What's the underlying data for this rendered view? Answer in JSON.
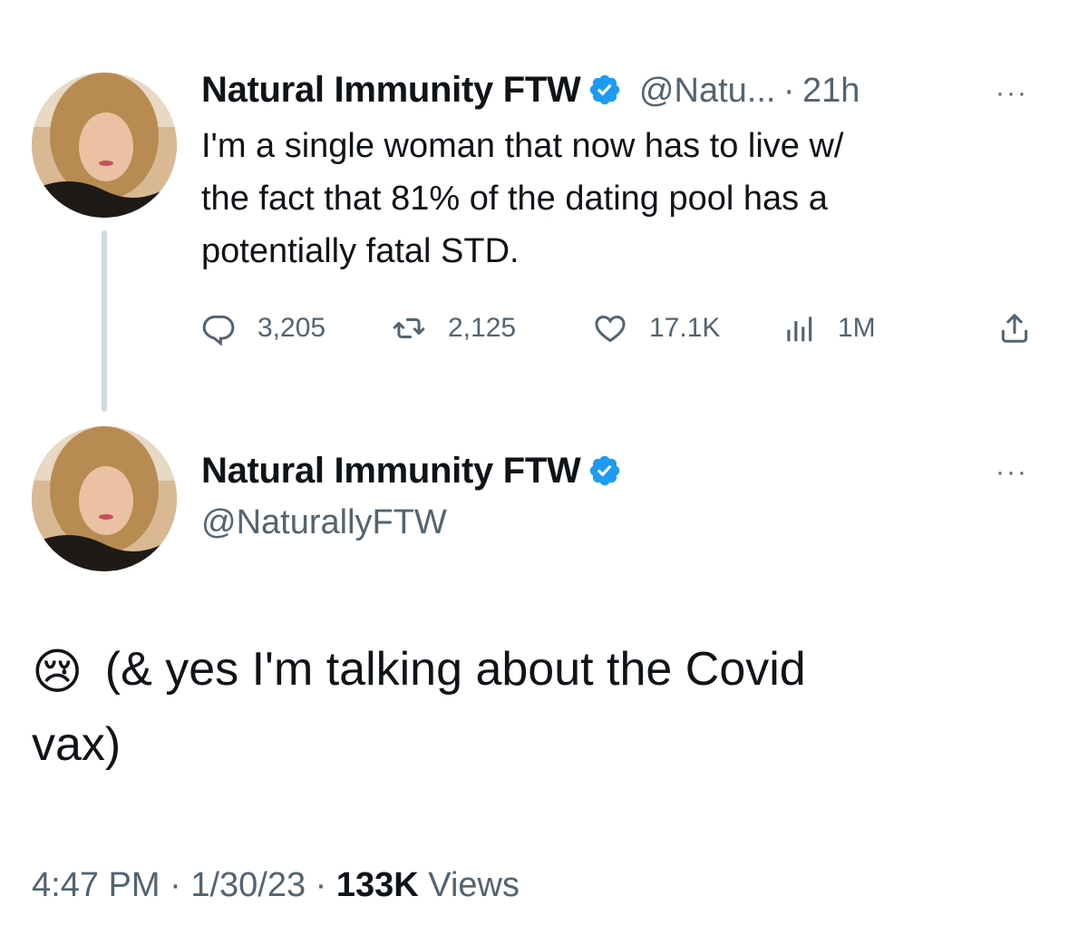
{
  "tweet1": {
    "name": "Natural Immunity FTW",
    "handle": "@Natu...",
    "separator": "·",
    "time": "21h",
    "more": "···",
    "text_lines": [
      "I'm a single woman that now has to live w/",
      "the fact that 81% of the dating pool has a",
      "potentially fatal STD."
    ],
    "actions": {
      "replies": "3,205",
      "retweets": "2,125",
      "likes": "17.1K",
      "views": "1M"
    }
  },
  "tweet2": {
    "name": "Natural Immunity FTW",
    "handle": "@NaturallyFTW",
    "more": "···",
    "emoji": "😢",
    "text_line1": "(& yes I'm talking about the Covid",
    "text_line2": "vax)",
    "footer": {
      "time": "4:47 PM",
      "sep1": "·",
      "date": "1/30/23",
      "sep2": "·",
      "views_count": "133K",
      "views_label": "Views"
    }
  },
  "colors": {
    "verified": "#1d9bf0",
    "secondary_text": "#536471",
    "primary_text": "#0f1419",
    "thread_line": "#cfd9de"
  },
  "icons": {
    "reply": "reply-icon",
    "retweet": "retweet-icon",
    "like": "like-icon",
    "views": "views-icon",
    "share": "share-icon",
    "verified": "verified-badge-icon"
  }
}
